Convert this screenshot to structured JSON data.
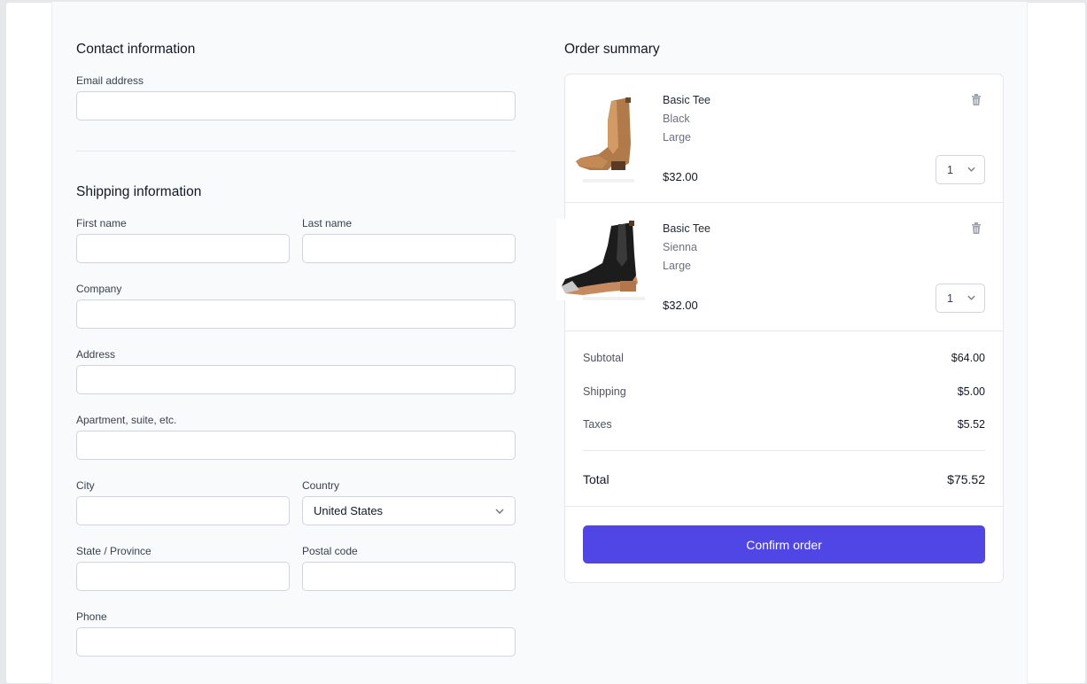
{
  "contact": {
    "title": "Contact information",
    "email_label": "Email address",
    "email_value": ""
  },
  "shipping": {
    "title": "Shipping information",
    "first_name_label": "First name",
    "last_name_label": "Last name",
    "company_label": "Company",
    "address_label": "Address",
    "apartment_label": "Apartment, suite, etc.",
    "city_label": "City",
    "country_label": "Country",
    "country_value": "United States",
    "state_label": "State / Province",
    "postal_label": "Postal code",
    "phone_label": "Phone"
  },
  "summary": {
    "title": "Order summary",
    "items": [
      {
        "name": "Basic Tee",
        "color": "Black",
        "size": "Large",
        "price": "$32.00",
        "quantity": "1",
        "image_icon": "tan-chelsea-boot"
      },
      {
        "name": "Basic Tee",
        "color": "Sienna",
        "size": "Large",
        "price": "$32.00",
        "quantity": "1",
        "image_icon": "black-chelsea-boot"
      }
    ],
    "subtotal_label": "Subtotal",
    "subtotal_value": "$64.00",
    "shipping_label": "Shipping",
    "shipping_value": "$5.00",
    "taxes_label": "Taxes",
    "taxes_value": "$5.52",
    "total_label": "Total",
    "total_value": "$75.52",
    "confirm_label": "Confirm order"
  },
  "colors": {
    "accent": "#4f46e5",
    "panel_bg": "#f9fafb",
    "border": "#d1d5db"
  }
}
